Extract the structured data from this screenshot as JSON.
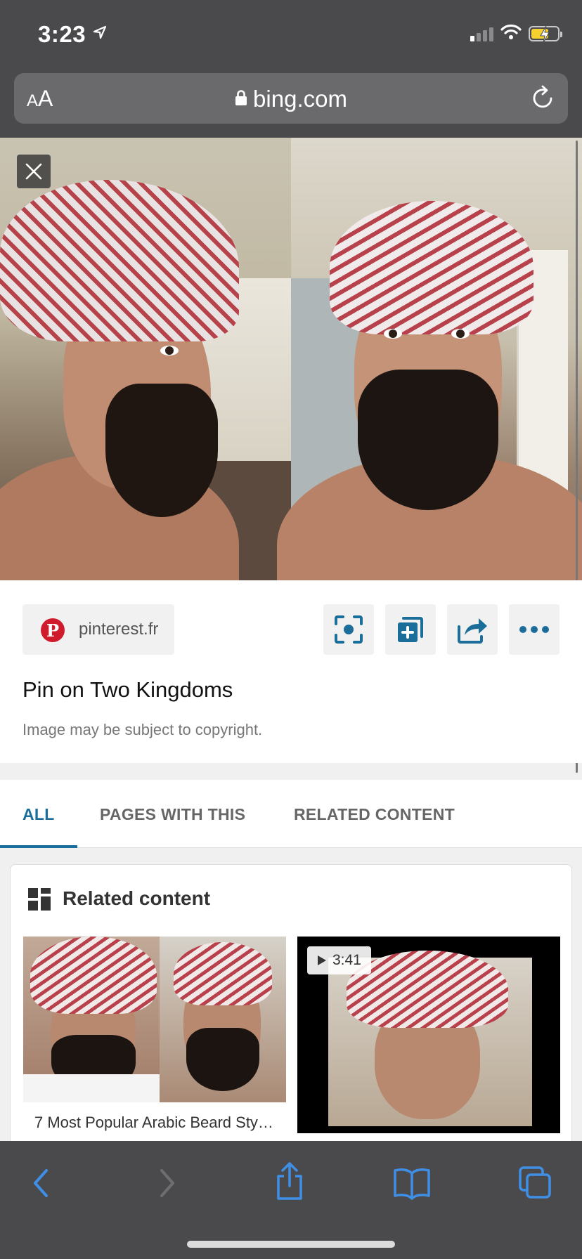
{
  "status_bar": {
    "time": "3:23",
    "signal_bars": 4,
    "signal_active": 1
  },
  "url_bar": {
    "text_size_small": "A",
    "text_size_big": "A",
    "domain": "bing.com"
  },
  "viewer": {
    "close_label": "Close"
  },
  "info": {
    "source": "pinterest.fr",
    "source_logo_letter": "P",
    "title": "Pin on Two Kingdoms",
    "note": "Image may be subject to copyright."
  },
  "tabs": [
    {
      "label": "ALL",
      "active": true
    },
    {
      "label": "PAGES WITH THIS",
      "active": false
    },
    {
      "label": "RELATED CONTENT",
      "active": false
    }
  ],
  "related": {
    "heading": "Related content",
    "items": [
      {
        "caption": "7 Most Popular Arabic Beard Sty…"
      },
      {
        "duration": "3:41"
      }
    ]
  },
  "colors": {
    "accent": "#1b6e99",
    "pinterest": "#cf1b2b",
    "toolbar_icon": "#3f8fe6"
  }
}
